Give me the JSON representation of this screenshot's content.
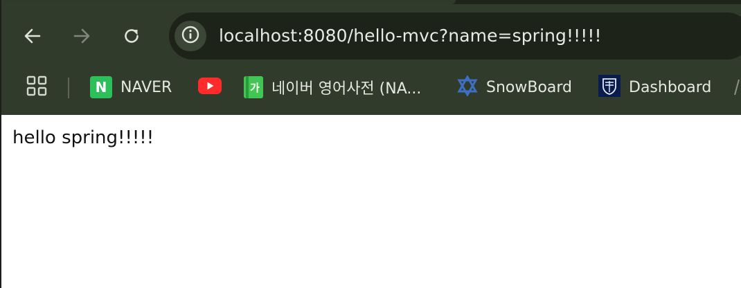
{
  "toolbar": {
    "back_icon": "arrow-left-icon",
    "forward_icon": "arrow-right-icon",
    "reload_icon": "reload-icon",
    "info_icon": "info-icon"
  },
  "address_bar": {
    "url": "localhost:8080/hello-mvc?name=spring!!!!!"
  },
  "bookmarks": {
    "apps_icon": "apps-grid-icon",
    "items": [
      {
        "label": "NAVER",
        "icon": "naver-icon",
        "icon_text": "N",
        "color": "#2dbf5a"
      },
      {
        "label": "",
        "icon": "youtube-icon",
        "color": "#ff2b2b"
      },
      {
        "label": "네이버 영어사전 (NA...",
        "icon": "dictionary-icon",
        "icon_text": "가",
        "color": "#41c553"
      },
      {
        "label": "SnowBoard",
        "icon": "star-of-david-icon",
        "color": "#2e5aa8"
      },
      {
        "label": "Dashboard",
        "icon": "crest-icon",
        "color": "#0a1b4d"
      }
    ]
  },
  "page": {
    "text": "hello spring!!!!!"
  },
  "colors": {
    "toolbar_bg": "#303b2c",
    "omnibox_bg": "#1d2319",
    "content_bg": "#ffffff"
  }
}
